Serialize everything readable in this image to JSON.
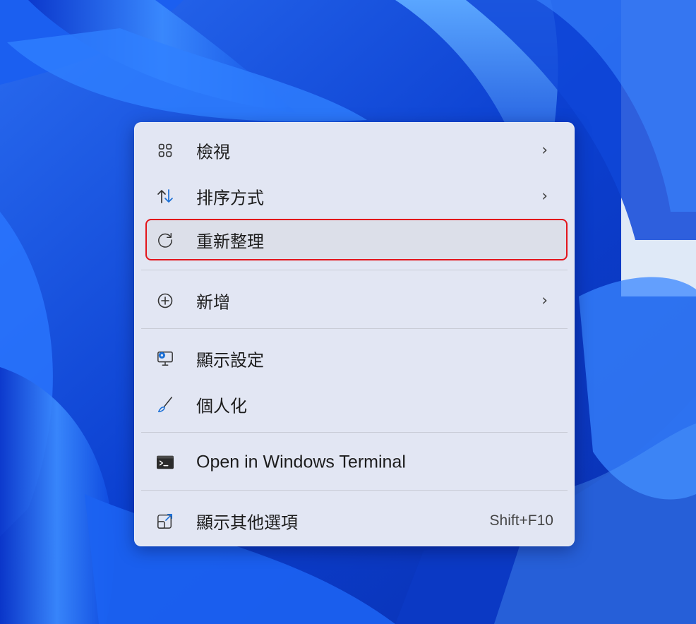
{
  "context_menu": {
    "items": [
      {
        "label": "檢視",
        "icon": "view-grid-icon",
        "has_submenu": true
      },
      {
        "label": "排序方式",
        "icon": "sort-arrows-icon",
        "has_submenu": true
      },
      {
        "label": "重新整理",
        "icon": "refresh-icon",
        "has_submenu": false,
        "highlighted": true
      },
      {
        "label": "新增",
        "icon": "add-circle-icon",
        "has_submenu": true
      },
      {
        "label": "顯示設定",
        "icon": "display-settings-icon",
        "has_submenu": false
      },
      {
        "label": "個人化",
        "icon": "brush-icon",
        "has_submenu": false
      },
      {
        "label": "Open in Windows Terminal",
        "icon": "terminal-icon",
        "has_submenu": false
      },
      {
        "label": "顯示其他選項",
        "icon": "more-options-icon",
        "has_submenu": false,
        "shortcut": "Shift+F10"
      }
    ],
    "submenu_glyph": "›"
  },
  "colors": {
    "highlight_border": "#e3141b",
    "menu_background": "#e2e6f3",
    "wallpaper_blue": "#0a43d6"
  }
}
